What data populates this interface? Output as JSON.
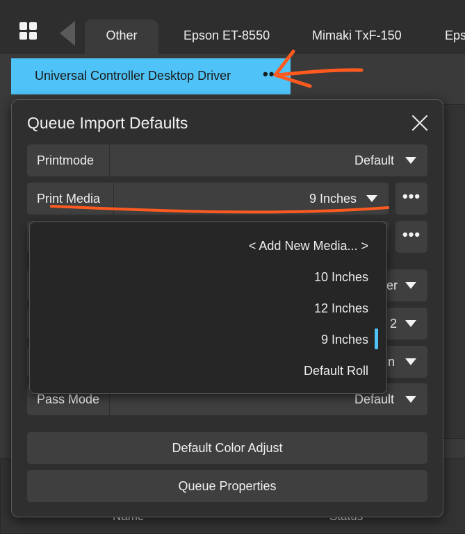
{
  "tabs": [
    {
      "label": "Other",
      "active": true
    },
    {
      "label": "Epson ET-8550",
      "active": false
    },
    {
      "label": "Mimaki TxF-150",
      "active": false
    },
    {
      "label": "Eps",
      "active": false
    }
  ],
  "driver": {
    "label": "Universal Controller Desktop Driver",
    "more": "•••"
  },
  "background": {
    "name_header": "Name",
    "status_header": "Status"
  },
  "dialog": {
    "title": "Queue Import Defaults",
    "printmode": {
      "label": "Printmode",
      "value": "Default"
    },
    "print_media": {
      "label": "Print Media",
      "value": "9 Inches",
      "more": "•••"
    },
    "row3_more": "•••",
    "peek_values": [
      "er",
      "2",
      "n"
    ],
    "pass_mode": {
      "label": "Pass Mode",
      "value": "Default"
    },
    "color_adjust_label": "Default Color Adjust",
    "queue_properties_label": "Queue Properties"
  },
  "dropdown": {
    "options": [
      "< Add New Media... >",
      "10 Inches",
      "12 Inches",
      "9 Inches",
      "Default Roll"
    ],
    "selected": "9 Inches"
  },
  "colors": {
    "accent": "#4fc3f7",
    "annotation": "#ff5a1f",
    "dialog_bg": "#2f2f2f"
  }
}
